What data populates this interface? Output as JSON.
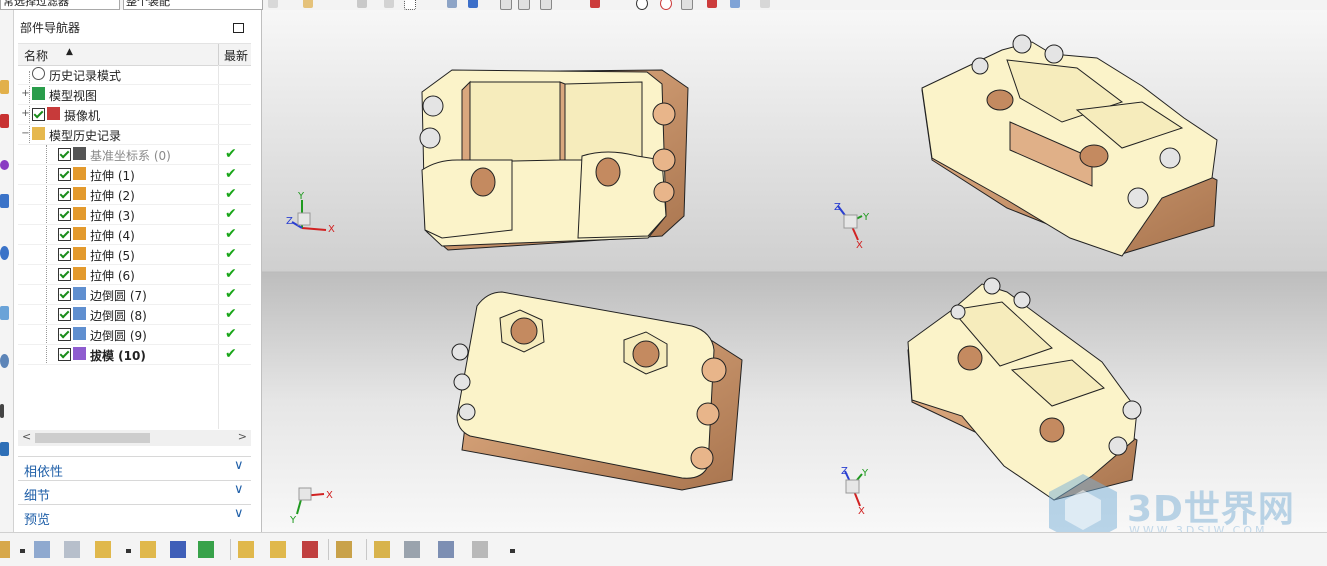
{
  "toolbar": {
    "filter_select": "常选择过滤器",
    "assembly_select": "整个装配"
  },
  "navigator": {
    "title": "部件导航器",
    "col_name": "名称",
    "col_latest": "最新",
    "rows": [
      {
        "label": "历史记录模式",
        "icon": "clock-icon",
        "expander": "",
        "checked": false,
        "status": false,
        "indent": 0,
        "greyed": false,
        "bold": false
      },
      {
        "label": "模型视图",
        "icon": "model-view-icon",
        "expander": "+",
        "checked": false,
        "status": false,
        "indent": 0,
        "greyed": false,
        "bold": false
      },
      {
        "label": "摄像机",
        "icon": "camera-icon",
        "expander": "+",
        "checked": true,
        "status": false,
        "indent": 0,
        "greyed": false,
        "bold": false
      },
      {
        "label": "模型历史记录",
        "icon": "folder-open-icon",
        "expander": "−",
        "checked": false,
        "status": false,
        "indent": 0,
        "greyed": false,
        "bold": false
      },
      {
        "label": "基准坐标系 (0)",
        "icon": "datum-csys-icon",
        "expander": "",
        "checked": true,
        "status": true,
        "indent": 1,
        "greyed": true,
        "bold": false
      },
      {
        "label": "拉伸 (1)",
        "icon": "extrude-icon",
        "expander": "",
        "checked": true,
        "status": true,
        "indent": 1,
        "greyed": false,
        "bold": false
      },
      {
        "label": "拉伸 (2)",
        "icon": "extrude-icon",
        "expander": "",
        "checked": true,
        "status": true,
        "indent": 1,
        "greyed": false,
        "bold": false
      },
      {
        "label": "拉伸 (3)",
        "icon": "extrude-icon",
        "expander": "",
        "checked": true,
        "status": true,
        "indent": 1,
        "greyed": false,
        "bold": false
      },
      {
        "label": "拉伸 (4)",
        "icon": "extrude-icon",
        "expander": "",
        "checked": true,
        "status": true,
        "indent": 1,
        "greyed": false,
        "bold": false
      },
      {
        "label": "拉伸 (5)",
        "icon": "extrude-icon",
        "expander": "",
        "checked": true,
        "status": true,
        "indent": 1,
        "greyed": false,
        "bold": false
      },
      {
        "label": "拉伸 (6)",
        "icon": "extrude-icon",
        "expander": "",
        "checked": true,
        "status": true,
        "indent": 1,
        "greyed": false,
        "bold": false
      },
      {
        "label": "边倒圆 (7)",
        "icon": "edge-blend-icon",
        "expander": "",
        "checked": true,
        "status": true,
        "indent": 1,
        "greyed": false,
        "bold": false
      },
      {
        "label": "边倒圆 (8)",
        "icon": "edge-blend-icon",
        "expander": "",
        "checked": true,
        "status": true,
        "indent": 1,
        "greyed": false,
        "bold": false
      },
      {
        "label": "边倒圆 (9)",
        "icon": "edge-blend-icon",
        "expander": "",
        "checked": true,
        "status": true,
        "indent": 1,
        "greyed": false,
        "bold": false
      },
      {
        "label": "拔模 (10)",
        "icon": "draft-icon",
        "expander": "",
        "checked": true,
        "status": true,
        "indent": 1,
        "greyed": false,
        "bold": true
      }
    ],
    "sections": [
      {
        "label": "相依性"
      },
      {
        "label": "细节"
      },
      {
        "label": "预览"
      }
    ]
  },
  "viewports": {
    "triad_labels": {
      "x": "X",
      "y": "Y",
      "z": "Z"
    }
  },
  "watermark": {
    "text": "3D世界网",
    "sub": "WWW.3DSJW.COM"
  },
  "colors": {
    "model_face": "#fbf3c9",
    "model_side": "#d9a77e",
    "viewport_bg_top": "#e7e7e7",
    "viewport_bg_bottom": "#c4c4c4",
    "status_green": "#19a619",
    "section_blue": "#1f5fa8"
  }
}
